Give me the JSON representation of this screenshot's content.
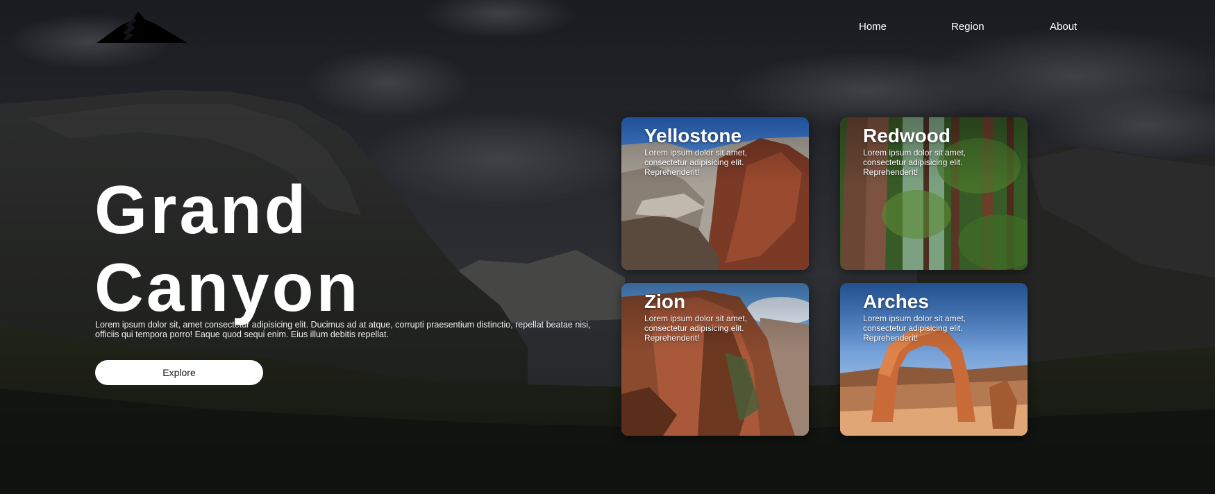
{
  "nav": {
    "items": [
      {
        "label": "Home"
      },
      {
        "label": "Region"
      },
      {
        "label": "About"
      }
    ]
  },
  "hero": {
    "title_line1": "Grand",
    "title_line2": "Canyon",
    "description": "Lorem ipsum dolor sit, amet consectetur adipisicing elit. Ducimus ad at atque, corrupti praesentium distinctio, repellat beatae nisi, officiis qui tempora porro! Eaque quod sequi enim. Eius illum debitis repellat.",
    "button_label": "Explore"
  },
  "cards": [
    {
      "title": "Yellostone",
      "text": "Lorem ipsum dolor sit amet, consectetur adipisicing elit. Reprehenderit!"
    },
    {
      "title": "Redwood",
      "text": "Lorem ipsum dolor sit amet, consectetur adipisicing elit. Reprehenderit!"
    },
    {
      "title": "Zion",
      "text": "Lorem ipsum dolor sit amet, consectetur adipisicing elit. Reprehenderit!"
    },
    {
      "title": "Arches",
      "text": "Lorem ipsum dolor sit amet, consectetur adipisicing elit. Reprehenderit!"
    }
  ],
  "icons": {
    "logo": "mountain-logo-icon"
  },
  "colors": {
    "text": "#ffffff",
    "button_bg": "#ffffff",
    "button_text": "#1a1a1a",
    "sky": "#2a2d33"
  }
}
